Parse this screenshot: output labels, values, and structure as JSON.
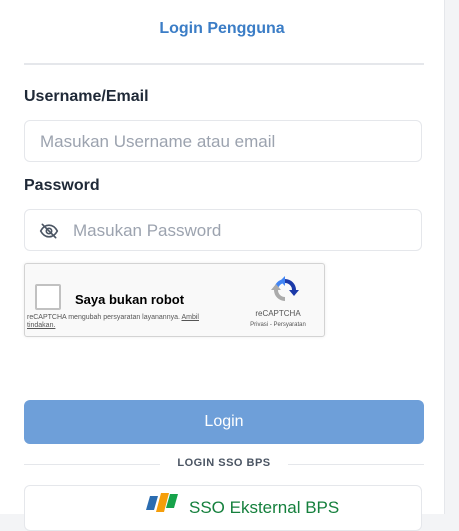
{
  "login": {
    "title": "Login Pengguna",
    "username_label": "Username/Email",
    "username_placeholder": "Masukan Username atau email",
    "password_label": "Password",
    "password_placeholder": "Masukan Password",
    "submit_label": "Login"
  },
  "recaptcha": {
    "label": "Saya bukan robot",
    "notice_text": "reCAPTCHA mengubah persyaratan layanannya.",
    "notice_link": "Ambil tindakan.",
    "brand": "reCAPTCHA",
    "privacy": "Privasi",
    "terms": "Persyaratan",
    "checked": false
  },
  "sso": {
    "divider_text": "LOGIN SSO BPS",
    "button_label": "SSO Eksternal BPS"
  },
  "colors": {
    "accent": "#3b7dc6",
    "button": "#6e9fd9",
    "sso_text": "#15803d"
  },
  "icons": {
    "password_toggle": "eye-off-icon",
    "recaptcha_logo": "recaptcha-logo-icon",
    "sso_logo": "bps-logo-icon"
  }
}
